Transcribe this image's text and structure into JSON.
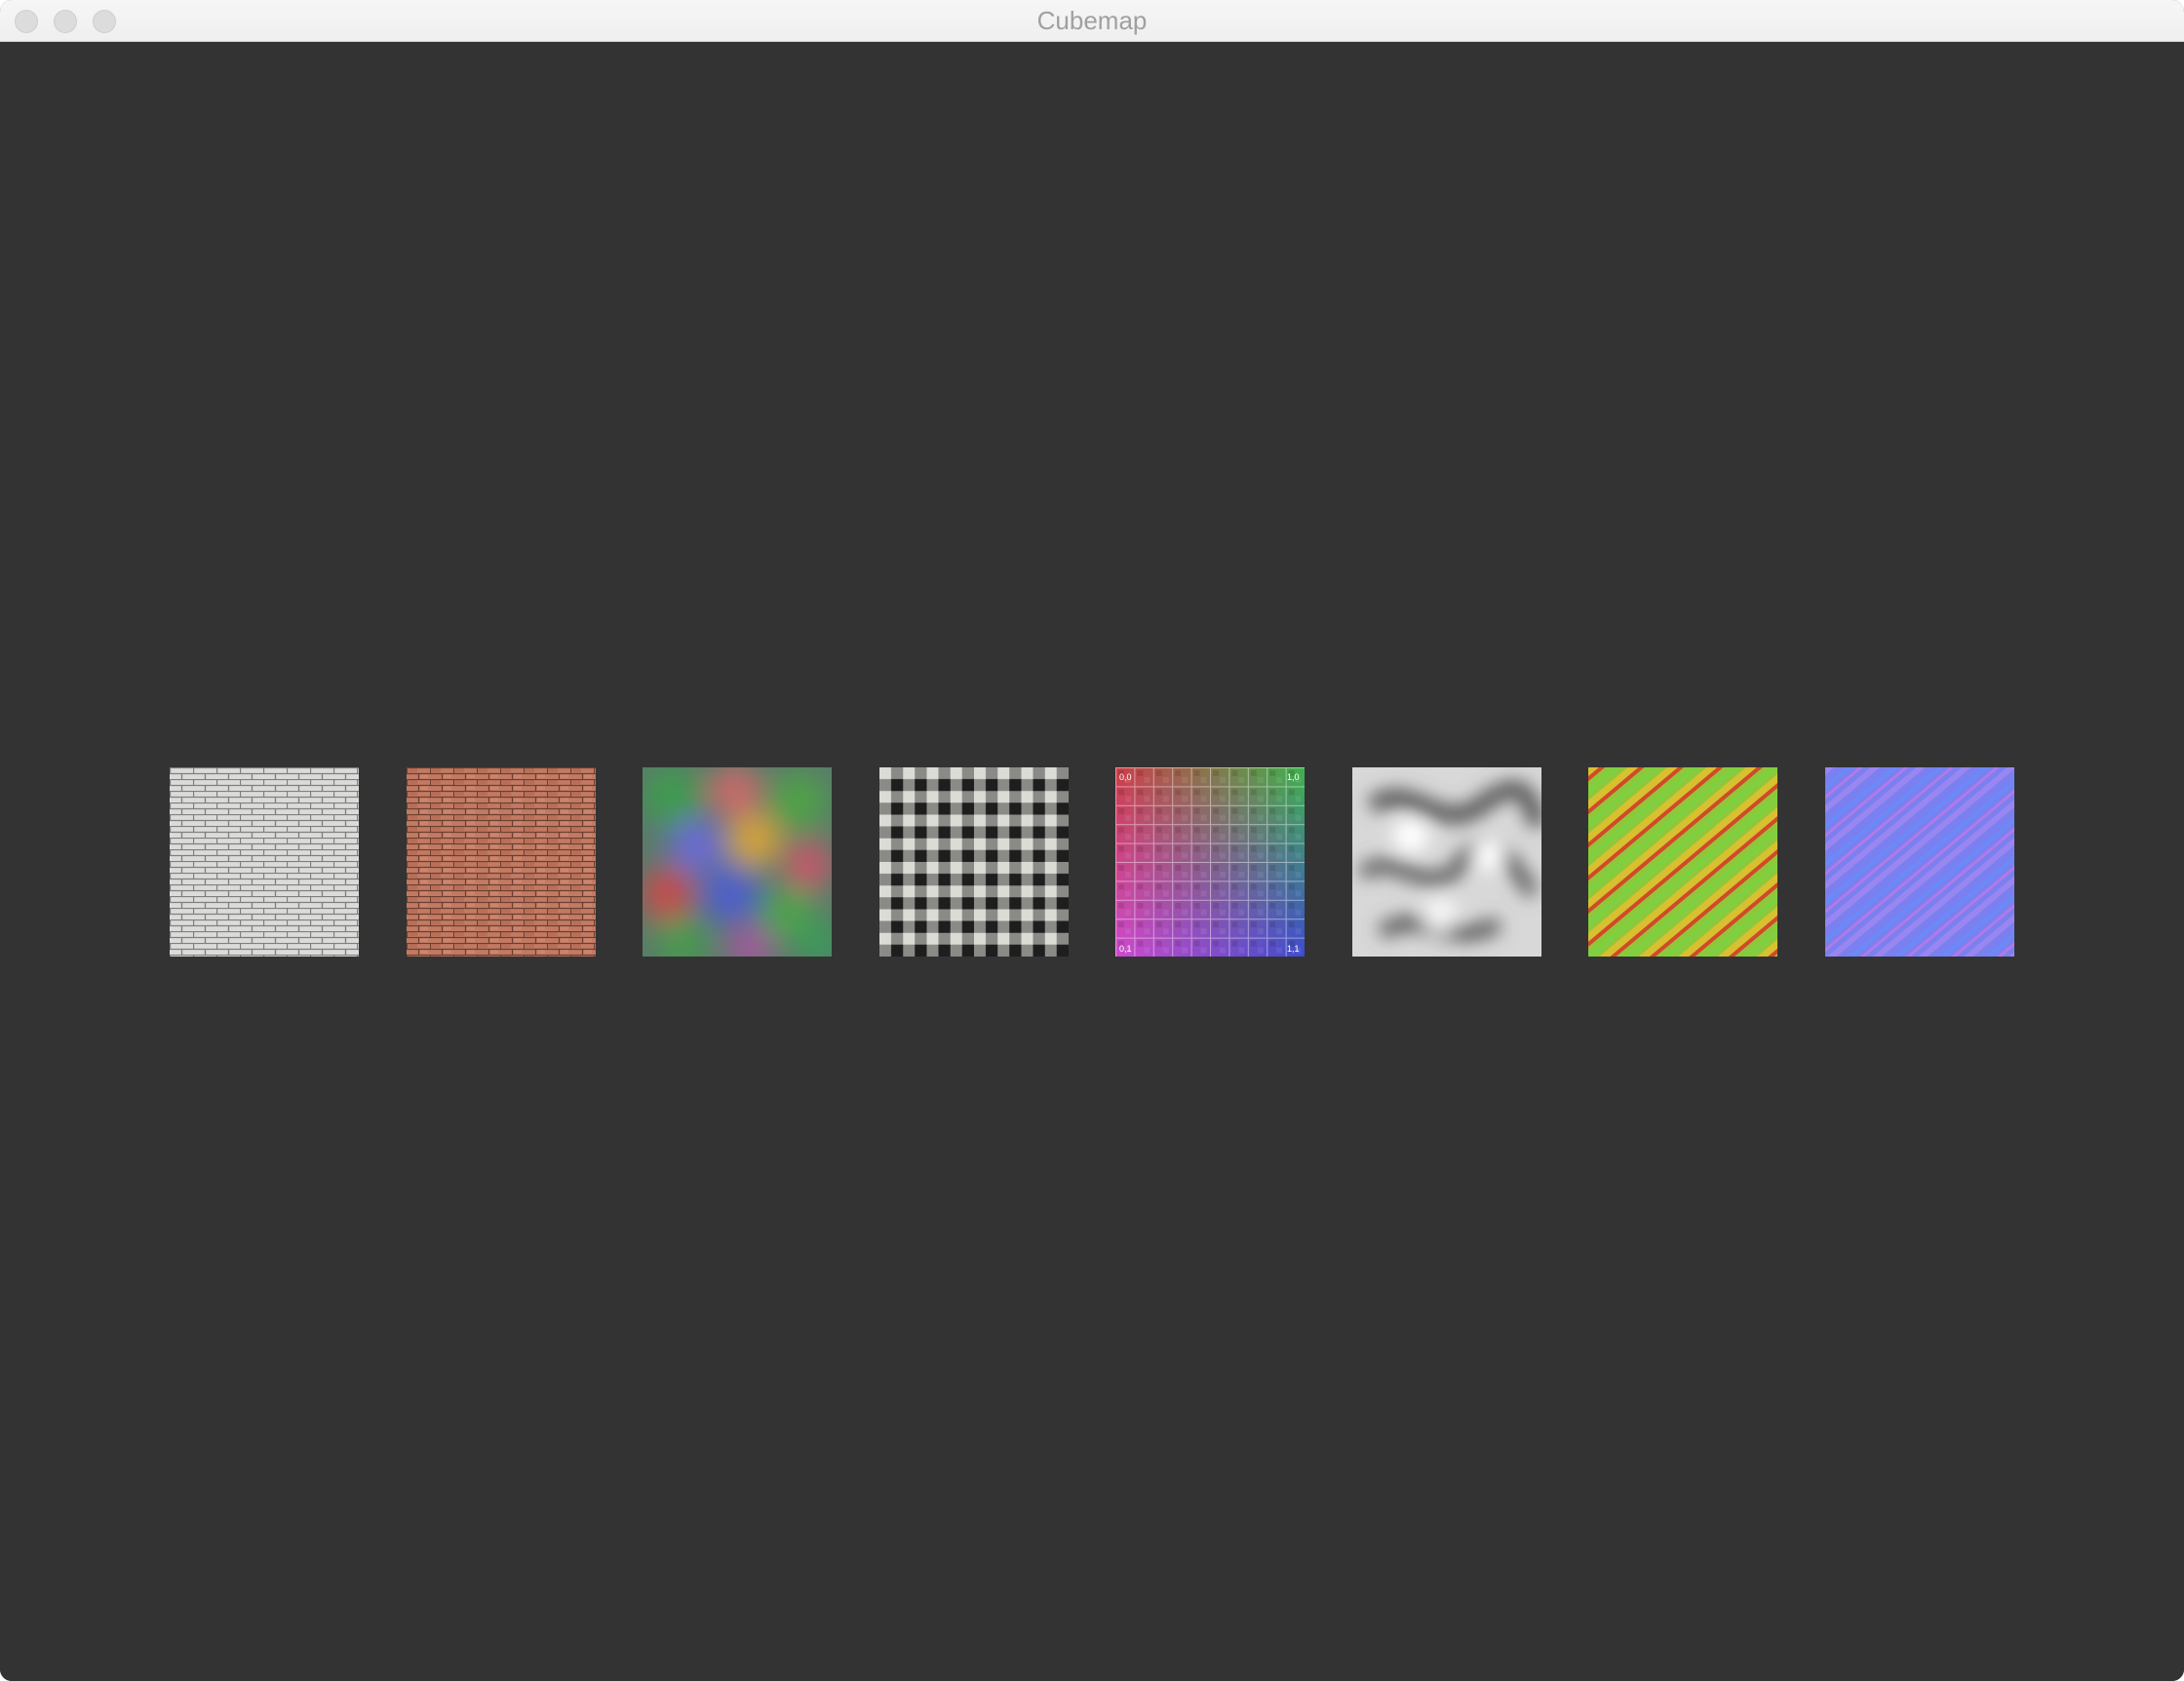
{
  "window": {
    "title": "Cubemap"
  },
  "colors": {
    "background": "#333333",
    "titlebar": "#f0f0f0",
    "title_text": "#a0a0a0"
  },
  "tiles": [
    {
      "name": "white-brick-texture",
      "icon": "white-brick-texture"
    },
    {
      "name": "red-brick-texture",
      "icon": "red-brick-texture"
    },
    {
      "name": "color-noise-texture",
      "icon": "color-noise-texture"
    },
    {
      "name": "checker-fabric-texture",
      "icon": "checker-fabric-texture"
    },
    {
      "name": "uv-grid-texture",
      "icon": "uv-grid-texture",
      "corner_labels": [
        "0,0",
        "1,0",
        "0,1",
        "1,1"
      ]
    },
    {
      "name": "cloud-noise-texture",
      "icon": "cloud-noise-texture"
    },
    {
      "name": "heightmap-texture",
      "icon": "heightmap-texture"
    },
    {
      "name": "normal-map-texture",
      "icon": "normal-map-texture"
    }
  ]
}
